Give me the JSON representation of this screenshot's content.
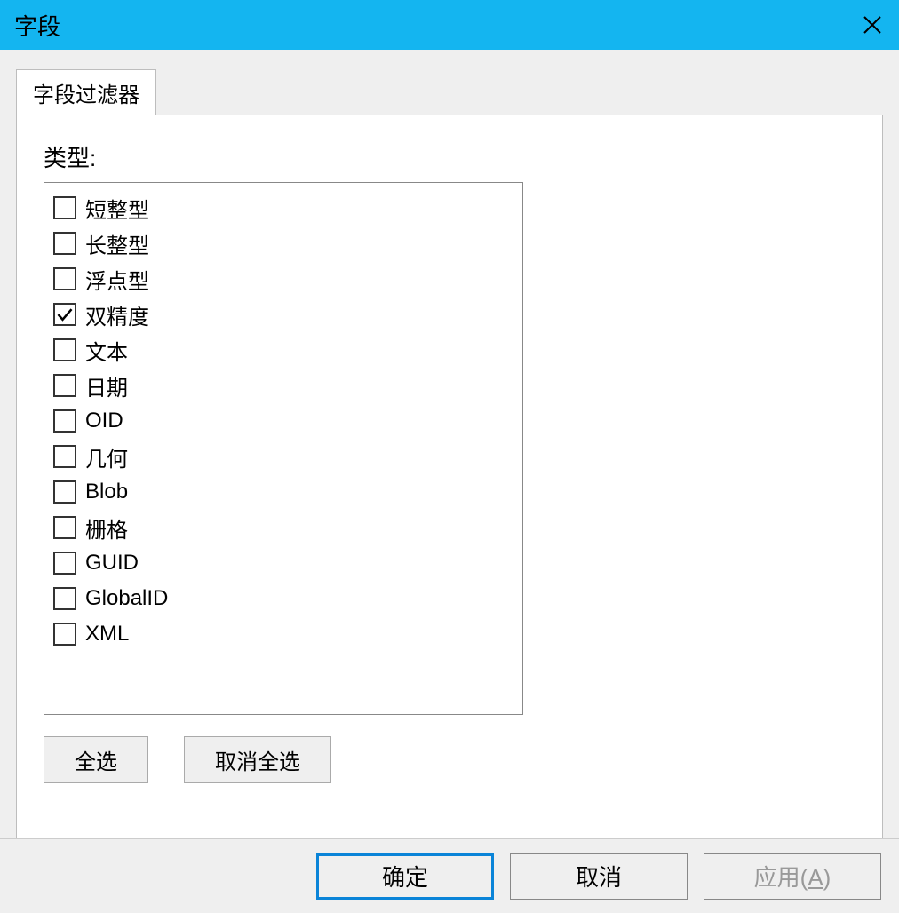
{
  "title": "字段",
  "tab": {
    "label": "字段过滤器"
  },
  "type_label": "类型:",
  "types": [
    {
      "label": "短整型",
      "checked": false
    },
    {
      "label": "长整型",
      "checked": false
    },
    {
      "label": "浮点型",
      "checked": false
    },
    {
      "label": "双精度",
      "checked": true
    },
    {
      "label": "文本",
      "checked": false
    },
    {
      "label": "日期",
      "checked": false
    },
    {
      "label": "OID",
      "checked": false
    },
    {
      "label": "几何",
      "checked": false
    },
    {
      "label": "Blob",
      "checked": false
    },
    {
      "label": "栅格",
      "checked": false
    },
    {
      "label": "GUID",
      "checked": false
    },
    {
      "label": "GlobalID",
      "checked": false
    },
    {
      "label": "XML",
      "checked": false
    }
  ],
  "buttons": {
    "select_all": "全选",
    "deselect_all": "取消全选",
    "ok": "确定",
    "cancel": "取消",
    "apply_prefix": "应用(",
    "apply_key": "A",
    "apply_suffix": ")"
  }
}
